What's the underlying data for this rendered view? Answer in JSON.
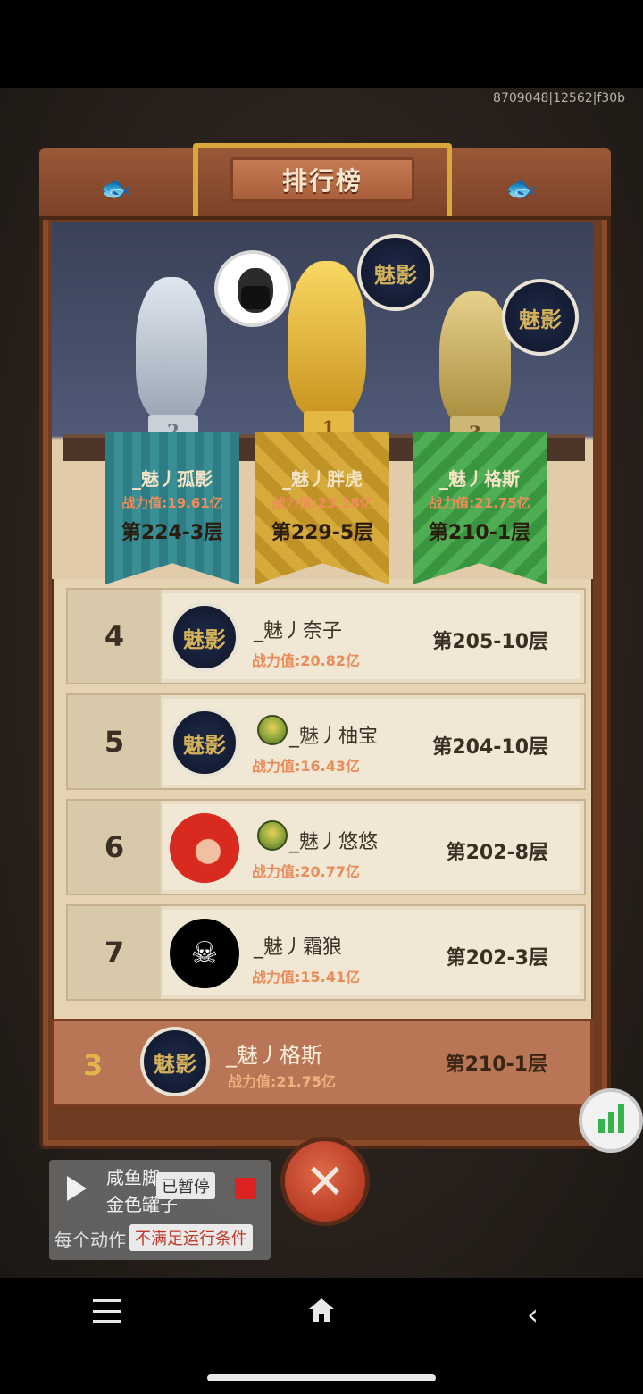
{
  "debug_id": "8709048|12562|f30b",
  "title": "排行榜",
  "podium": [
    {
      "rank": "2",
      "name": "_魅丿孤影",
      "power": "战力值:19.61亿",
      "floor": "第224-3层",
      "avatar": "photo-avatar"
    },
    {
      "rank": "1",
      "name": "_魅丿胖虎",
      "power": "战力值:23.18亿",
      "floor": "第229-5层",
      "avatar": "guild-logo-avatar"
    },
    {
      "rank": "3",
      "name": "_魅丿格斯",
      "power": "战力值:21.75亿",
      "floor": "第210-1层",
      "avatar": "guild-logo-avatar"
    }
  ],
  "rows": [
    {
      "rank": "4",
      "name": "_魅丿奈子",
      "power": "战力值:20.82亿",
      "floor": "第205-10层"
    },
    {
      "rank": "5",
      "name": "_魅丿柚宝",
      "power": "战力值:16.43亿",
      "floor": "第204-10层"
    },
    {
      "rank": "6",
      "name": "_魅丿悠悠",
      "power": "战力值:20.77亿",
      "floor": "第202-8层"
    },
    {
      "rank": "7",
      "name": "_魅丿霜狼",
      "power": "战力值:15.41亿",
      "floor": "第202-3层"
    }
  ],
  "self": {
    "rank": "3",
    "name": "_魅丿格斯",
    "power": "战力值:21.75亿",
    "floor": "第210-1层"
  },
  "logo_text": "魅影",
  "overlay": {
    "line1": "咸鱼脚",
    "line2": "金色罐子",
    "line3": "每个动作",
    "paused": "已暂停",
    "condition": "不满足运行条件"
  },
  "colors": {
    "silver_banner": "#2f7f86",
    "gold_banner": "#c49a2a",
    "bronze_banner": "#3f9a44",
    "power_text": "#e98c5a",
    "self_row": "#b87656"
  }
}
